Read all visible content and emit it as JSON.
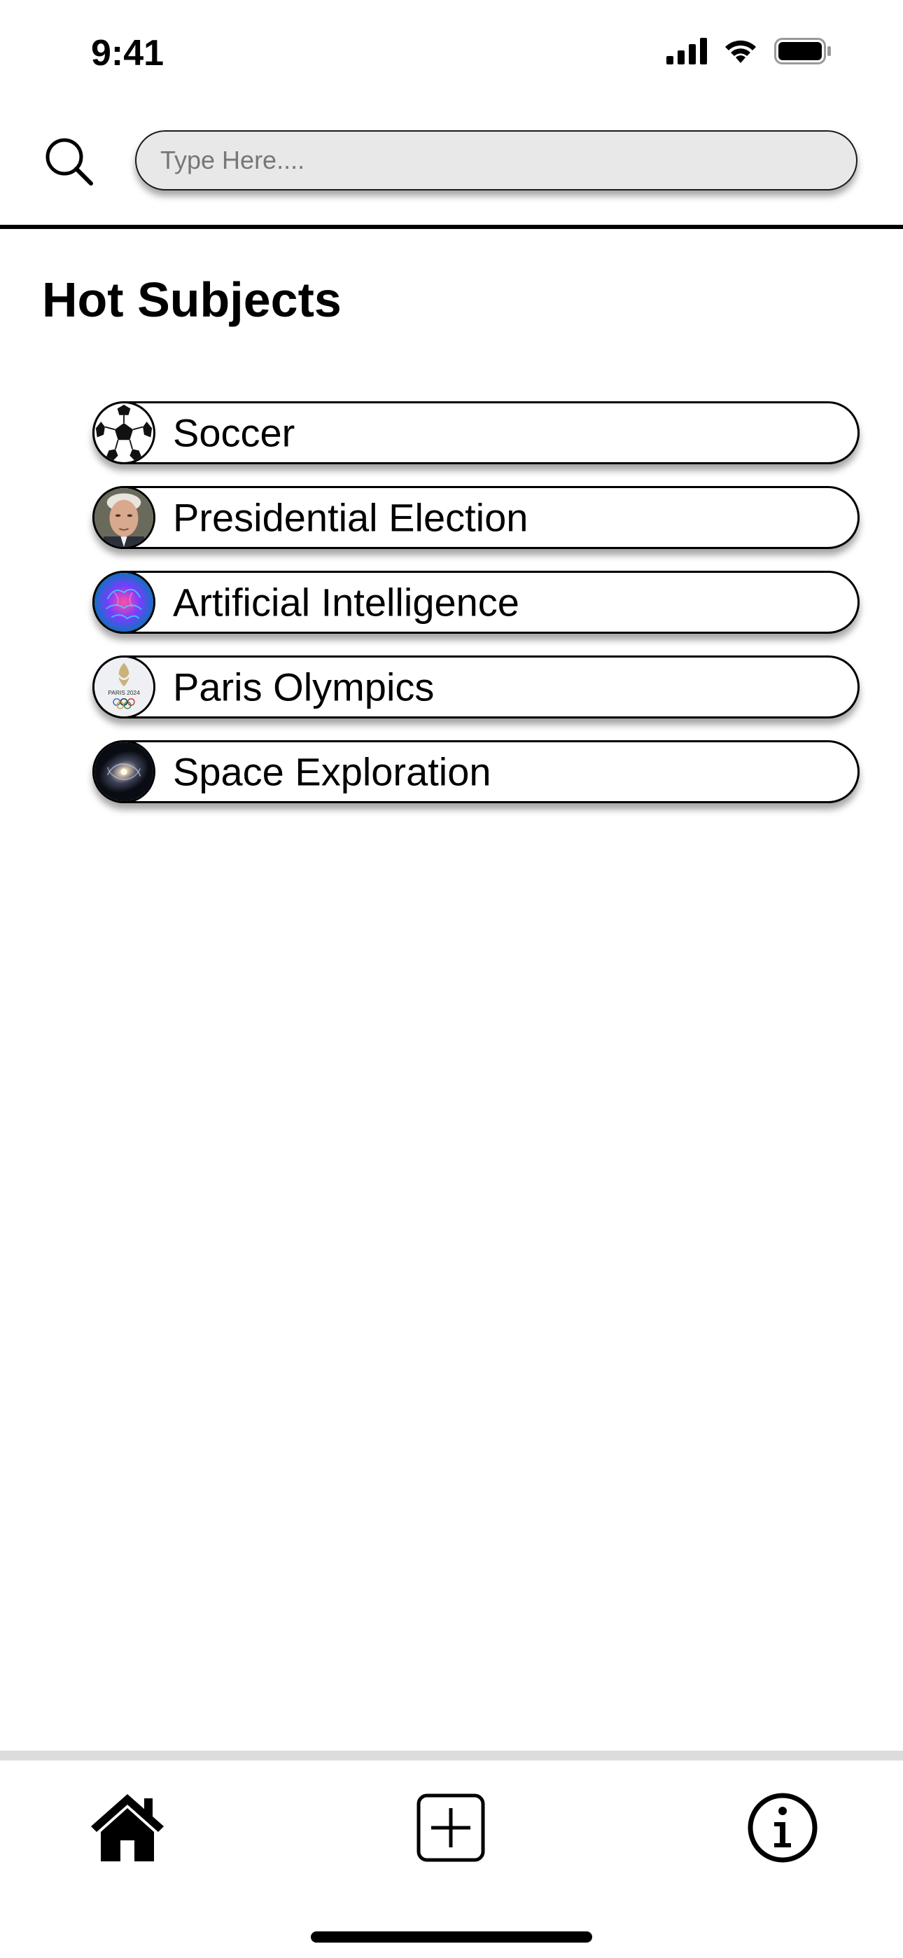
{
  "status_bar": {
    "time": "9:41",
    "icons": [
      "cellular-signal-icon",
      "wifi-icon",
      "battery-icon"
    ]
  },
  "search": {
    "placeholder": "Type Here....",
    "value": "",
    "icon": "search-icon"
  },
  "section": {
    "title": "Hot Subjects"
  },
  "topics": [
    {
      "label": "Soccer",
      "icon": "soccer-ball-icon"
    },
    {
      "label": "Presidential Election",
      "icon": "portrait-thumbnail"
    },
    {
      "label": "Artificial Intelligence",
      "icon": "brain-thumbnail"
    },
    {
      "label": "Paris Olympics",
      "icon": "paris-2024-logo-thumbnail"
    },
    {
      "label": "Space Exploration",
      "icon": "galaxy-thumbnail"
    }
  ],
  "tab_bar": {
    "items": [
      {
        "name": "home",
        "icon": "home-icon"
      },
      {
        "name": "add",
        "icon": "plus-square-icon"
      },
      {
        "name": "info",
        "icon": "info-icon"
      }
    ]
  }
}
